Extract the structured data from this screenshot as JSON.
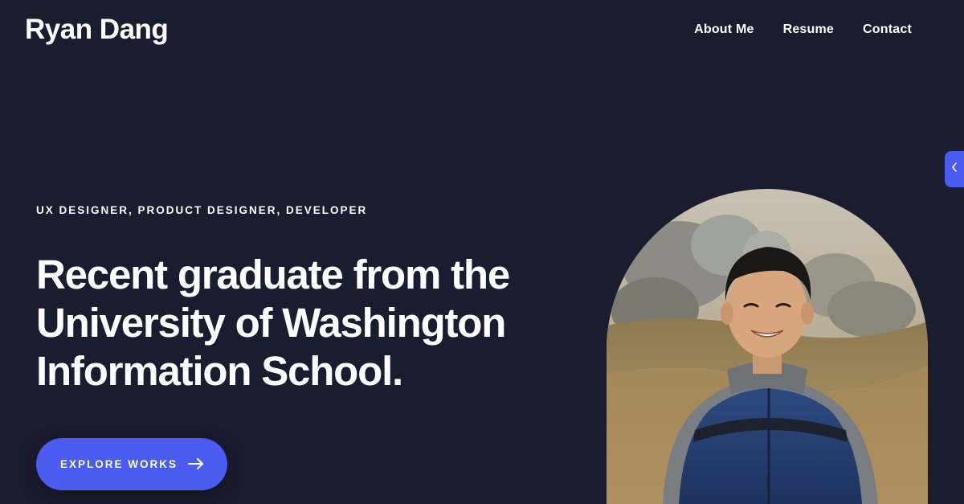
{
  "header": {
    "brand": "Ryan Dang",
    "nav": [
      {
        "label": "About Me"
      },
      {
        "label": "Resume"
      },
      {
        "label": "Contact"
      }
    ]
  },
  "side_tab": {
    "icon": "chevron-left-icon"
  },
  "hero": {
    "eyebrow": "UX DESIGNER, PRODUCT DESIGNER, DEVELOPER",
    "headline": "Recent graduate from the University of Washington Information School.",
    "cta_label": "EXPLORE WORKS",
    "cta_icon": "arrow-right-icon"
  },
  "colors": {
    "background": "#1a1c2f",
    "accent": "#4a5cf0",
    "text": "#ffffff"
  }
}
